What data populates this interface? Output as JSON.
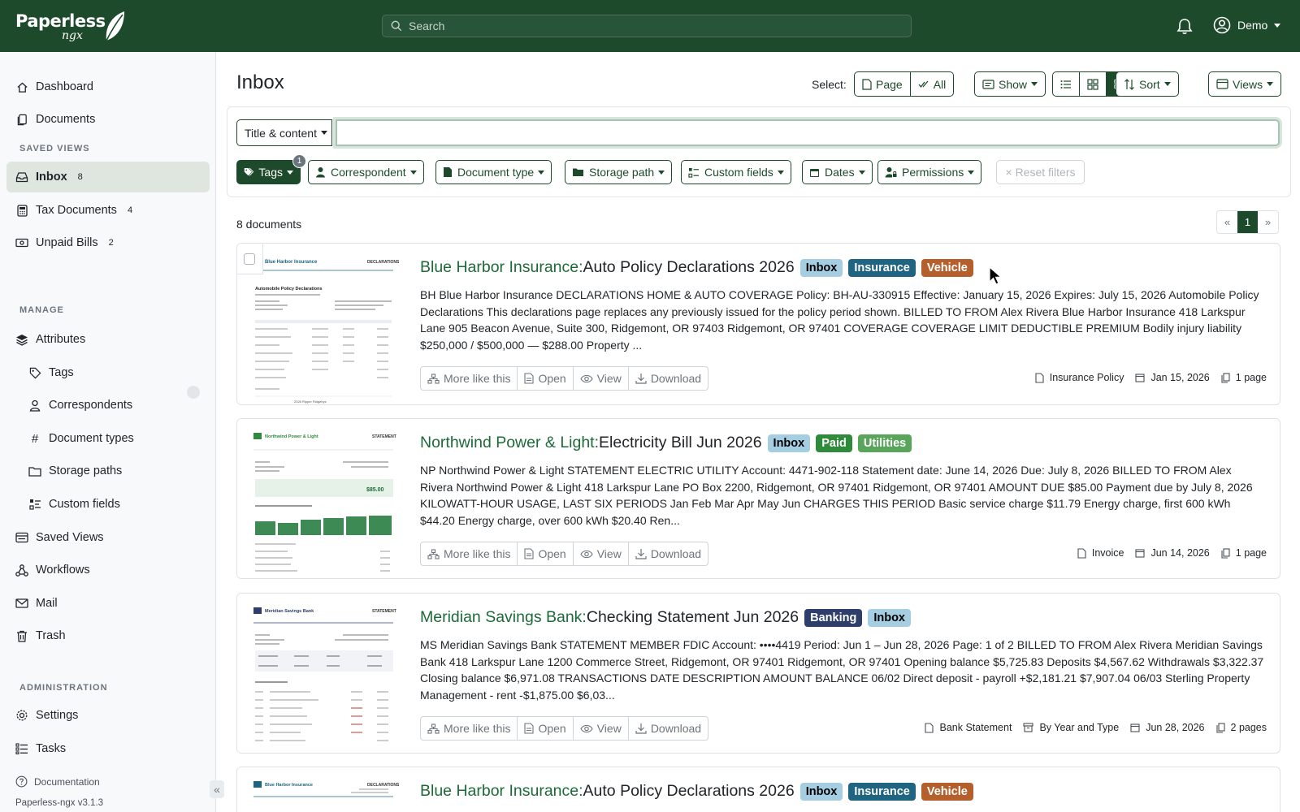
{
  "app": {
    "logo_main": "Paperless",
    "logo_sub": "ngx",
    "search_placeholder": "Search",
    "user_name": "Demo"
  },
  "sidebar": {
    "top_items": [
      {
        "label": "Dashboard",
        "icon": "house-icon"
      },
      {
        "label": "Documents",
        "icon": "files-icon"
      }
    ],
    "saved_views_heading": "SAVED VIEWS",
    "saved_views": [
      {
        "label": "Inbox",
        "count": "8",
        "icon": "inbox-icon"
      },
      {
        "label": "Tax Documents",
        "count": "4",
        "icon": "calculator-icon"
      },
      {
        "label": "Unpaid Bills",
        "count": "2",
        "icon": "cash-icon"
      }
    ],
    "manage_heading": "MANAGE",
    "attributes_label": "Attributes",
    "attribute_items": [
      {
        "label": "Tags",
        "icon": "tag-icon"
      },
      {
        "label": "Correspondents",
        "icon": "person-icon"
      },
      {
        "label": "Document types",
        "icon": "hash-icon"
      },
      {
        "label": "Storage paths",
        "icon": "folder-icon"
      },
      {
        "label": "Custom fields",
        "icon": "ui-checks-icon"
      }
    ],
    "manage_items": [
      {
        "label": "Saved Views",
        "icon": "saved-views-icon"
      },
      {
        "label": "Workflows",
        "icon": "workflows-icon"
      },
      {
        "label": "Mail",
        "icon": "envelope-icon"
      },
      {
        "label": "Trash",
        "icon": "trash-icon"
      }
    ],
    "admin_heading": "ADMINISTRATION",
    "admin_items": [
      {
        "label": "Settings",
        "icon": "gear-icon"
      },
      {
        "label": "Tasks",
        "icon": "list-task-icon"
      }
    ],
    "documentation": "Documentation",
    "version": "Paperless-ngx v3.1.3",
    "collapse": "«"
  },
  "toolbar": {
    "page_title": "Inbox",
    "select_label": "Select:",
    "select_page": "Page",
    "select_all": "All",
    "show": "Show",
    "sort": "Sort",
    "views": "Views"
  },
  "filters": {
    "text_mode": "Title & content",
    "text_value": "",
    "tags": "Tags",
    "tags_count": "1",
    "correspondent": "Correspondent",
    "document_type": "Document type",
    "storage_path": "Storage path",
    "custom_fields": "Custom fields",
    "dates": "Dates",
    "permissions": "Permissions",
    "reset": "× Reset filters"
  },
  "results": {
    "count_text": "8 documents",
    "pager": {
      "prev": "«",
      "current": "1",
      "next": "»"
    }
  },
  "tag_colors": {
    "Inbox": {
      "bg": "#a6cee3",
      "fg": "#000000"
    },
    "Insurance": {
      "bg": "#1f6481",
      "fg": "#ffffff"
    },
    "Vehicle": {
      "bg": "#b45f2c",
      "fg": "#ffffff"
    },
    "Paid": {
      "bg": "#2e8b3c",
      "fg": "#ffffff"
    },
    "Utilities": {
      "bg": "#5aa55c",
      "fg": "#ffffff"
    },
    "Banking": {
      "bg": "#2d3e6a",
      "fg": "#ffffff"
    }
  },
  "documents": [
    {
      "correspondent": "Blue Harbor Insurance:",
      "title": " Auto Policy Declarations 2026",
      "tags": [
        "Inbox",
        "Insurance",
        "Vehicle"
      ],
      "snippet": "BH Blue Harbor Insurance DECLARATIONS HOME & AUTO COVERAGE Policy: BH-AU-330915 Effective: January 15, 2026 Expires: July 15, 2026 Automobile Policy Declarations This declarations page replaces any previously issued for the policy period shown. BILLED TO FROM Alex Rivera Blue Harbor Insurance 418 Larkspur Lane 905 Beacon Avenue, Suite 300, Ridgemont, OR 97403 Ridgemont, OR 97401 COVERAGE COVERAGE LIMIT DEDUCTIBLE PREMIUM Bodily injury liability $250,000 / $500,000 — $288.00 Property ...",
      "doc_type": "Insurance Policy",
      "storage_path": "",
      "date": "Jan 15, 2026",
      "pages": "1 page"
    },
    {
      "correspondent": "Northwind Power & Light:",
      "title": " Electricity Bill Jun 2026",
      "tags": [
        "Inbox",
        "Paid",
        "Utilities"
      ],
      "snippet": "NP Northwind Power & Light STATEMENT ELECTRIC UTILITY Account: 4471-902-118 Statement date: June 14, 2026 Due: July 8, 2026 BILLED TO FROM Alex Rivera Northwind Power & Light 418 Larkspur Lane PO Box 2200, Ridgemont, OR 97401 Ridgemont, OR 97401 AMOUNT DUE $85.00 Payment due by July 8, 2026 KILOWATT-HOUR USAGE, LAST SIX PERIODS Jan Feb Mar Apr May Jun CHARGES THIS PERIOD Basic service charge $11.79 Energy charge, first 600 kWh $44.20 Energy charge, over 600 kWh $20.40 Ren...",
      "doc_type": "Invoice",
      "storage_path": "",
      "date": "Jun 14, 2026",
      "pages": "1 page"
    },
    {
      "correspondent": "Meridian Savings Bank:",
      "title": " Checking Statement Jun 2026",
      "tags": [
        "Banking",
        "Inbox"
      ],
      "snippet": "MS Meridian Savings Bank STATEMENT MEMBER FDIC Account: ••••4419 Period: Jun 1 – Jun 28, 2026 Page: 1 of 2 BILLED TO FROM Alex Rivera Meridian Savings Bank 418 Larkspur Lane 1200 Commerce Street, Ridgemont, OR 97401 Ridgemont, OR 97401 Opening balance $5,725.83 Deposits $4,567.62 Withdrawals $3,322.37 Closing balance $6,971.08 TRANSACTIONS DATE DESCRIPTION AMOUNT BALANCE 06/02 Direct deposit - payroll +$2,181.21 $7,907.04 06/03 Sterling Property Management - rent -$1,875.00 $6,03...",
      "doc_type": "Bank Statement",
      "storage_path": "By Year and Type",
      "date": "Jun 28, 2026",
      "pages": "2 pages"
    },
    {
      "correspondent": "Blue Harbor Insurance:",
      "title": " Auto Policy Declarations 2026",
      "tags": [
        "Inbox",
        "Insurance",
        "Vehicle"
      ],
      "snippet": "",
      "doc_type": "",
      "storage_path": "",
      "date": "",
      "pages": ""
    }
  ],
  "card_actions": {
    "more_like_this": "More like this",
    "open": "Open",
    "view": "View",
    "download": "Download"
  },
  "thumbnails": [
    {
      "header": "Blue Harbor Insurance",
      "doc_label": "DECLARATIONS",
      "section": "Automobile Policy Declarations",
      "footer": "2026 Ripper Ridgebys"
    },
    {
      "header": "Northwind Power & Light",
      "doc_label": "STATEMENT",
      "amount": "$85.00"
    },
    {
      "header": "Meridian Savings Bank",
      "doc_label": "STATEMENT"
    },
    {
      "header": "Blue Harbor Insurance",
      "doc_label": "DECLARATIONS"
    }
  ]
}
